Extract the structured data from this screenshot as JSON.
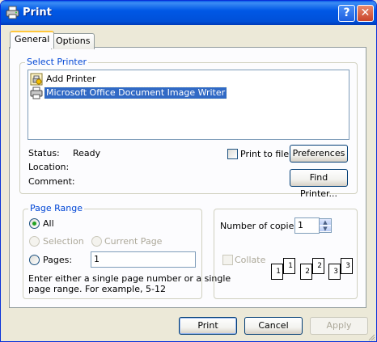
{
  "window": {
    "title": "Print",
    "help_button": "?",
    "close_button": "✕"
  },
  "tabs": [
    {
      "label": "General",
      "selected": true
    },
    {
      "label": "Options",
      "selected": false
    }
  ],
  "select_printer": {
    "group_label": "Select Printer",
    "printers": [
      {
        "label": "Add Printer",
        "icon": "add-printer-icon",
        "selected": false
      },
      {
        "label": "Microsoft Office Document Image Writer",
        "icon": "printer-icon",
        "selected": true
      }
    ],
    "status_label": "Status:",
    "status_value": "Ready",
    "location_label": "Location:",
    "location_value": "",
    "comment_label": "Comment:",
    "comment_value": "",
    "print_to_file_label": "Print to file",
    "print_to_file_checked": false,
    "preferences_button": "Preferences",
    "find_printer_button": "Find Printer..."
  },
  "page_range": {
    "group_label": "Page Range",
    "all_label": "All",
    "selection_label": "Selection",
    "current_page_label": "Current Page",
    "pages_label": "Pages:",
    "pages_value": "1",
    "selected_option": "All",
    "help_text_line1": "Enter either a single page number or a single",
    "help_text_line2": "page range.  For example, 5-12"
  },
  "copies": {
    "number_label": "Number of copies:",
    "number_value": "1",
    "collate_label": "Collate",
    "collate_checked": false,
    "collate_pages": [
      "1",
      "1",
      "2",
      "2",
      "3",
      "3"
    ]
  },
  "footer": {
    "print_button": "Print",
    "cancel_button": "Cancel",
    "apply_button": "Apply"
  },
  "colors": {
    "titlebar": "#0058e6",
    "group_label": "#0046d5",
    "selection": "#316ac5",
    "dialog_background": "#ece9d8"
  }
}
